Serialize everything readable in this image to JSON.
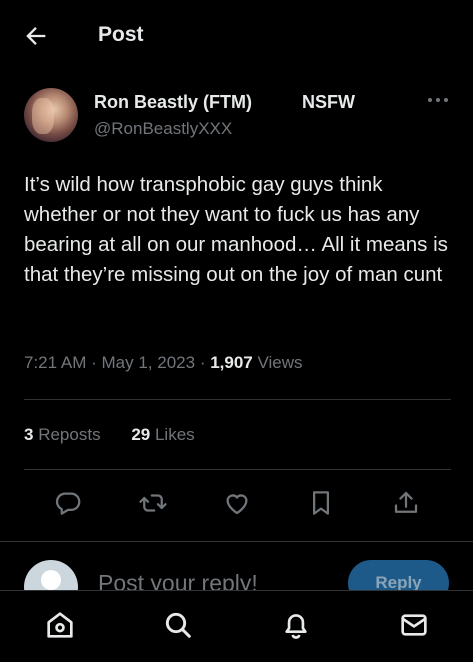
{
  "header": {
    "title": "Post"
  },
  "author": {
    "name": "Ron Beastly (FTM)",
    "handle": "@RonBeastlyXXX",
    "badge": "NSFW"
  },
  "post": {
    "text": "It’s wild how transphobic gay guys think whether or not they want to fuck us has any bearing at all on our manhood… All it means is that they’re missing out on the joy of man cunt",
    "time": "7:21 AM",
    "separator": "·",
    "date": "May 1, 2023",
    "views_count": "1,907",
    "views_label": "Views"
  },
  "stats": {
    "reposts_count": "3",
    "reposts_label": "Reposts",
    "likes_count": "29",
    "likes_label": "Likes"
  },
  "actions": [
    "reply-icon",
    "repost-icon",
    "like-icon",
    "bookmark-icon",
    "share-icon"
  ],
  "reply_bar": {
    "placeholder": "Post your reply!",
    "button_label": "Reply"
  },
  "bottom_nav": [
    "home-icon",
    "search-icon",
    "notifications-icon",
    "messages-icon"
  ],
  "colors": {
    "background": "#000000",
    "text": "#e7e9ea",
    "muted": "#71767b",
    "divider": "#2f3336",
    "reply_button": "#1d5a8a"
  }
}
